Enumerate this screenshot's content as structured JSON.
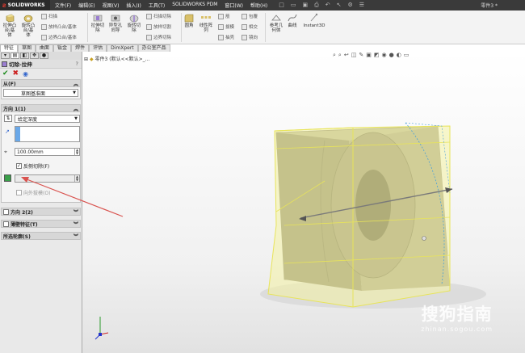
{
  "app": {
    "brand": "SOLIDWORKS",
    "menu": [
      "文件(F)",
      "编辑(E)",
      "视图(V)",
      "插入(I)",
      "工具(T)",
      "SOLIDWORKS PDM",
      "窗口(W)",
      "帮助(H)"
    ],
    "doc_title": "零件3 *"
  },
  "ribbon": {
    "extrude_boss": "拉伸凸\n台/基\n体",
    "revolve_boss": "旋转凸\n台/基\n体",
    "sweep": "扫描",
    "loft_boss": "放样凸台/基体",
    "boundary_boss": "边界凸台/基体",
    "extrude_cut": "拉伸切\n除",
    "hole_wizard": "异型孔\n向导",
    "revolve_cut": "旋转切\n除",
    "swept_cut": "扫描切除",
    "loft_cut": "放样切割",
    "boundary_cut": "边界切除",
    "fillet": "圆角",
    "linear_pattern": "线性阵\n列",
    "rib": "筋",
    "draft": "拔模",
    "shell": "抽壳",
    "wrap": "包覆",
    "intersect": "相交",
    "mirror": "镜向",
    "ref_geometry": "参考几\n何体",
    "curves": "曲线",
    "instant3d": "Instant3D"
  },
  "tabs": [
    "特征",
    "草图",
    "曲面",
    "钣金",
    "焊件",
    "评估",
    "DimXpert",
    "办公室产品"
  ],
  "panel": {
    "feature_title": "切除-拉伸",
    "help_mark": "?",
    "from": {
      "header": "从(F)",
      "value": "草图基准面"
    },
    "direction1": {
      "header": "方向 1(1)",
      "end_condition": "给定深度",
      "depth": "100.00mm",
      "flip_side": "反侧切除(F)",
      "draft_outward": "向外拔模(O)"
    },
    "direction2": {
      "header": "方向 2(2)"
    },
    "thin": {
      "header": "薄壁特征(T)"
    },
    "contours": {
      "header": "所选轮廓(S)"
    }
  },
  "viewport": {
    "tree_label": "零件3  (默认<<默认>_..."
  },
  "watermark": {
    "logo": "搜狗指南",
    "url": "zhinan.sogou.com"
  },
  "colors": {
    "accent_arrow": "#d9534f",
    "preview_yellow": "#f4f3a3",
    "body_gray": "#b8b49c"
  }
}
